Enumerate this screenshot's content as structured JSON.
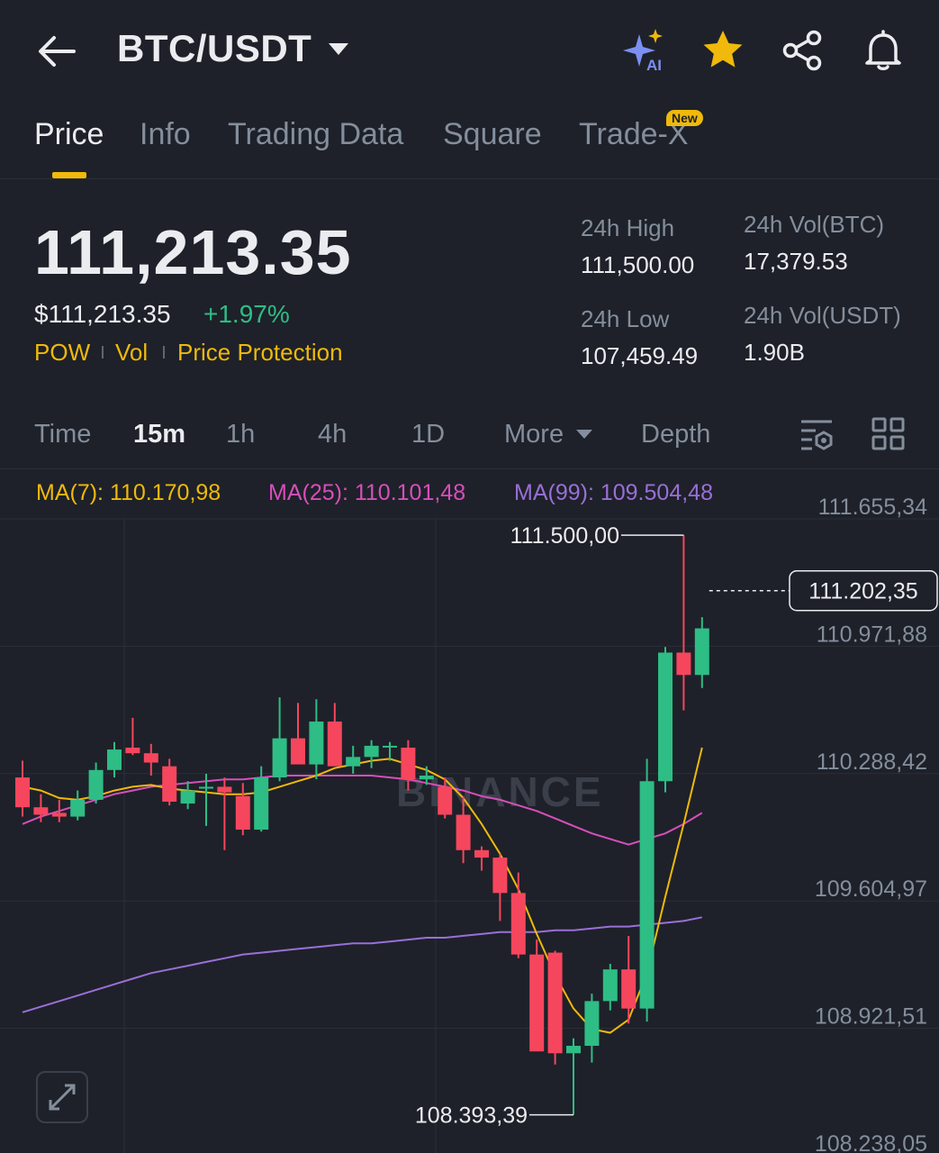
{
  "header": {
    "title": "BTC/USDT",
    "icons": [
      "back-arrow-icon",
      "caret-down-icon",
      "ai-sparkle-icon",
      "star-icon",
      "share-icon",
      "bell-icon"
    ],
    "ai_label": "AI"
  },
  "tabs": [
    {
      "label": "Price",
      "active": true
    },
    {
      "label": "Info"
    },
    {
      "label": "Trading Data"
    },
    {
      "label": "Square"
    },
    {
      "label": "Trade-X",
      "badge": "New"
    }
  ],
  "price": {
    "last": "111,213.35",
    "fiat": "$111,213.35",
    "change_pct": "+1.97%",
    "tags": [
      "POW",
      "Vol",
      "Price Protection"
    ]
  },
  "stats": {
    "high_label": "24h High",
    "high": "111,500.00",
    "low_label": "24h Low",
    "low": "107,459.49",
    "vol_btc_label": "24h Vol(BTC)",
    "vol_btc": "17,379.53",
    "vol_usdt_label": "24h Vol(USDT)",
    "vol_usdt": "1.90B"
  },
  "intervals": {
    "items": [
      "Time",
      "15m",
      "1h",
      "4h",
      "1D",
      "More",
      "Depth"
    ],
    "selected": "15m"
  },
  "ma": {
    "ma7": {
      "label": "MA(7): 110.170,98",
      "color": "#f0b90b"
    },
    "ma25": {
      "label": "MA(25): 110.101,48",
      "color": "#d64fbb"
    },
    "ma99": {
      "label": "MA(99): 109.504,48",
      "color": "#9a6fd8"
    }
  },
  "colors": {
    "up": "#2ebd85",
    "down": "#f6465d",
    "accent": "#f0b90b"
  },
  "chart_data": {
    "type": "candlestick",
    "y_axis_ticks": [
      "111.655,34",
      "110.971,88",
      "110.288,42",
      "109.604,97",
      "108.921,51",
      "108.238,05"
    ],
    "ylim": [
      108238.05,
      111655.34
    ],
    "high_marker": "111.500,00",
    "low_marker": "108.393,39",
    "current_price_label": "111.202,35",
    "current_price": 111202.35,
    "watermark": "BINANCE",
    "candles": [
      {
        "o": 110200,
        "h": 110290,
        "l": 109990,
        "c": 110040
      },
      {
        "o": 110040,
        "h": 110110,
        "l": 109960,
        "c": 110000
      },
      {
        "o": 110010,
        "h": 110080,
        "l": 109960,
        "c": 109990
      },
      {
        "o": 109990,
        "h": 110130,
        "l": 109970,
        "c": 110080
      },
      {
        "o": 110080,
        "h": 110280,
        "l": 110060,
        "c": 110240
      },
      {
        "o": 110240,
        "h": 110390,
        "l": 110200,
        "c": 110350
      },
      {
        "o": 110360,
        "h": 110520,
        "l": 110320,
        "c": 110330
      },
      {
        "o": 110330,
        "h": 110380,
        "l": 110210,
        "c": 110280
      },
      {
        "o": 110260,
        "h": 110300,
        "l": 110050,
        "c": 110070
      },
      {
        "o": 110060,
        "h": 110180,
        "l": 110030,
        "c": 110130
      },
      {
        "o": 110140,
        "h": 110220,
        "l": 109940,
        "c": 110150
      },
      {
        "o": 110150,
        "h": 110200,
        "l": 109810,
        "c": 110120
      },
      {
        "o": 110100,
        "h": 110170,
        "l": 109890,
        "c": 109920
      },
      {
        "o": 109920,
        "h": 110260,
        "l": 109910,
        "c": 110200
      },
      {
        "o": 110200,
        "h": 110630,
        "l": 110180,
        "c": 110410
      },
      {
        "o": 110410,
        "h": 110600,
        "l": 110330,
        "c": 110270
      },
      {
        "o": 110270,
        "h": 110620,
        "l": 110190,
        "c": 110500
      },
      {
        "o": 110500,
        "h": 110600,
        "l": 110280,
        "c": 110260
      },
      {
        "o": 110260,
        "h": 110370,
        "l": 110220,
        "c": 110310
      },
      {
        "o": 110310,
        "h": 110400,
        "l": 110250,
        "c": 110370
      },
      {
        "o": 110370,
        "h": 110390,
        "l": 110290,
        "c": 110370
      },
      {
        "o": 110360,
        "h": 110400,
        "l": 110130,
        "c": 110190
      },
      {
        "o": 110190,
        "h": 110260,
        "l": 110160,
        "c": 110210
      },
      {
        "o": 110150,
        "h": 110200,
        "l": 109980,
        "c": 110000
      },
      {
        "o": 110000,
        "h": 110100,
        "l": 109740,
        "c": 109810
      },
      {
        "o": 109810,
        "h": 109830,
        "l": 109700,
        "c": 109770
      },
      {
        "o": 109770,
        "h": 109790,
        "l": 109430,
        "c": 109580
      },
      {
        "o": 109580,
        "h": 109690,
        "l": 109230,
        "c": 109250
      },
      {
        "o": 109250,
        "h": 109330,
        "l": 108880,
        "c": 108730
      },
      {
        "o": 109260,
        "h": 109270,
        "l": 108660,
        "c": 108720
      },
      {
        "o": 108720,
        "h": 108800,
        "l": 108390,
        "c": 108760
      },
      {
        "o": 108760,
        "h": 109040,
        "l": 108670,
        "c": 109000
      },
      {
        "o": 109000,
        "h": 109200,
        "l": 108950,
        "c": 109170
      },
      {
        "o": 109170,
        "h": 109350,
        "l": 108880,
        "c": 108960
      },
      {
        "o": 108960,
        "h": 110300,
        "l": 108890,
        "c": 110180
      },
      {
        "o": 110180,
        "h": 110900,
        "l": 110120,
        "c": 110870
      },
      {
        "o": 110870,
        "h": 111500,
        "l": 110560,
        "c": 110750
      },
      {
        "o": 110750,
        "h": 111060,
        "l": 110680,
        "c": 111000
      }
    ],
    "ma7": [
      110150,
      110130,
      110090,
      110080,
      110100,
      110130,
      110150,
      110160,
      110140,
      110130,
      110120,
      110110,
      110110,
      110120,
      110150,
      110180,
      110210,
      110250,
      110270,
      110290,
      110300,
      110270,
      110240,
      110190,
      110090,
      109950,
      109790,
      109600,
      109360,
      109140,
      108960,
      108850,
      108830,
      108900,
      109150,
      109560,
      109950,
      110360
    ],
    "ma25": [
      109950,
      109990,
      110020,
      110050,
      110080,
      110110,
      110130,
      110150,
      110160,
      110170,
      110180,
      110190,
      110190,
      110200,
      110210,
      110210,
      110210,
      110210,
      110210,
      110210,
      110200,
      110190,
      110170,
      110150,
      110130,
      110100,
      110080,
      110050,
      110020,
      109980,
      109940,
      109900,
      109870,
      109840,
      109870,
      109900,
      109950,
      110010
    ],
    "ma99": [
      108940,
      108970,
      109000,
      109030,
      109060,
      109090,
      109120,
      109150,
      109170,
      109190,
      109210,
      109230,
      109250,
      109260,
      109270,
      109280,
      109290,
      109300,
      109310,
      109310,
      109320,
      109330,
      109340,
      109340,
      109350,
      109360,
      109370,
      109370,
      109370,
      109380,
      109380,
      109390,
      109400,
      109400,
      109410,
      109420,
      109430,
      109450
    ]
  }
}
